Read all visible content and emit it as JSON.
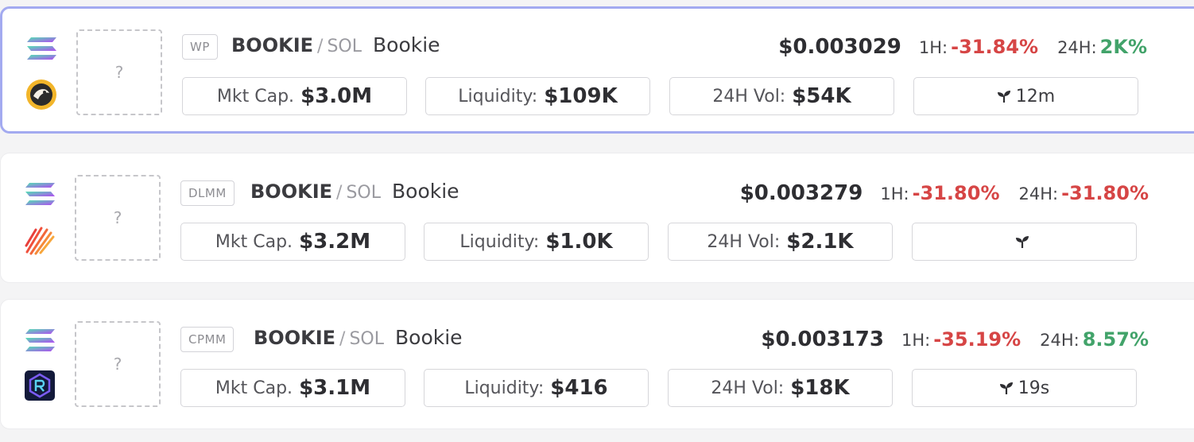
{
  "pools": [
    {
      "selected": true,
      "pool_type": "WP",
      "base_symbol": "BOOKIE",
      "quote_symbol": "SOL",
      "token_name": "Bookie",
      "thumbnail_placeholder": "?",
      "price": "$0.003029",
      "change_1h_label": "1H:",
      "change_1h": "-31.84%",
      "change_1h_trend": "negative",
      "change_24h_label": "24H:",
      "change_24h": "2K%",
      "change_24h_trend": "positive",
      "mkt_cap_label": "Mkt Cap.",
      "mkt_cap": "$3.0M",
      "liquidity_label": "Liquidity:",
      "liquidity": "$109K",
      "volume_label": "24H Vol:",
      "volume_24h": "$54K",
      "age": "12m",
      "chain_icon": "solana-icon",
      "dex_icon": "pumpfun-duck-icon"
    },
    {
      "selected": false,
      "pool_type": "DLMM",
      "base_symbol": "BOOKIE",
      "quote_symbol": "SOL",
      "token_name": "Bookie",
      "thumbnail_placeholder": "?",
      "price": "$0.003279",
      "change_1h_label": "1H:",
      "change_1h": "-31.80%",
      "change_1h_trend": "negative",
      "change_24h_label": "24H:",
      "change_24h": "-31.80%",
      "change_24h_trend": "negative",
      "mkt_cap_label": "Mkt Cap.",
      "mkt_cap": "$3.2M",
      "liquidity_label": "Liquidity:",
      "liquidity": "$1.0K",
      "volume_label": "24H Vol:",
      "volume_24h": "$2.1K",
      "age": "",
      "chain_icon": "solana-icon",
      "dex_icon": "meteora-icon"
    },
    {
      "selected": false,
      "pool_type": "CPMM",
      "base_symbol": "BOOKIE",
      "quote_symbol": "SOL",
      "token_name": "Bookie",
      "thumbnail_placeholder": "?",
      "price": "$0.003173",
      "change_1h_label": "1H:",
      "change_1h": "-35.19%",
      "change_1h_trend": "negative",
      "change_24h_label": "24H:",
      "change_24h": "8.57%",
      "change_24h_trend": "positive",
      "mkt_cap_label": "Mkt Cap.",
      "mkt_cap": "$3.1M",
      "liquidity_label": "Liquidity:",
      "liquidity": "$416",
      "volume_label": "24H Vol:",
      "volume_24h": "$18K",
      "age": "19s",
      "chain_icon": "solana-icon",
      "dex_icon": "raydium-icon"
    }
  ],
  "colors": {
    "selected_border": "#a3aaf0",
    "negative": "#d64545",
    "positive": "#42a36a"
  }
}
